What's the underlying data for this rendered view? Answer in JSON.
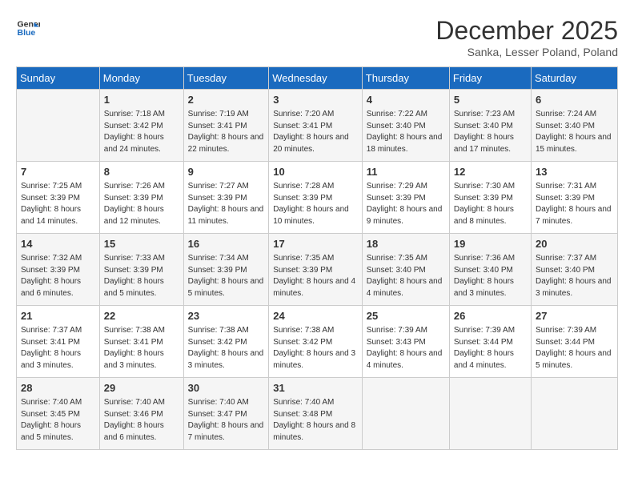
{
  "logo": {
    "line1": "General",
    "line2": "Blue"
  },
  "title": "December 2025",
  "subtitle": "Sanka, Lesser Poland, Poland",
  "headers": [
    "Sunday",
    "Monday",
    "Tuesday",
    "Wednesday",
    "Thursday",
    "Friday",
    "Saturday"
  ],
  "weeks": [
    [
      {
        "day": "",
        "sunrise": "",
        "sunset": "",
        "daylight": ""
      },
      {
        "day": "1",
        "sunrise": "Sunrise: 7:18 AM",
        "sunset": "Sunset: 3:42 PM",
        "daylight": "Daylight: 8 hours and 24 minutes."
      },
      {
        "day": "2",
        "sunrise": "Sunrise: 7:19 AM",
        "sunset": "Sunset: 3:41 PM",
        "daylight": "Daylight: 8 hours and 22 minutes."
      },
      {
        "day": "3",
        "sunrise": "Sunrise: 7:20 AM",
        "sunset": "Sunset: 3:41 PM",
        "daylight": "Daylight: 8 hours and 20 minutes."
      },
      {
        "day": "4",
        "sunrise": "Sunrise: 7:22 AM",
        "sunset": "Sunset: 3:40 PM",
        "daylight": "Daylight: 8 hours and 18 minutes."
      },
      {
        "day": "5",
        "sunrise": "Sunrise: 7:23 AM",
        "sunset": "Sunset: 3:40 PM",
        "daylight": "Daylight: 8 hours and 17 minutes."
      },
      {
        "day": "6",
        "sunrise": "Sunrise: 7:24 AM",
        "sunset": "Sunset: 3:40 PM",
        "daylight": "Daylight: 8 hours and 15 minutes."
      }
    ],
    [
      {
        "day": "7",
        "sunrise": "Sunrise: 7:25 AM",
        "sunset": "Sunset: 3:39 PM",
        "daylight": "Daylight: 8 hours and 14 minutes."
      },
      {
        "day": "8",
        "sunrise": "Sunrise: 7:26 AM",
        "sunset": "Sunset: 3:39 PM",
        "daylight": "Daylight: 8 hours and 12 minutes."
      },
      {
        "day": "9",
        "sunrise": "Sunrise: 7:27 AM",
        "sunset": "Sunset: 3:39 PM",
        "daylight": "Daylight: 8 hours and 11 minutes."
      },
      {
        "day": "10",
        "sunrise": "Sunrise: 7:28 AM",
        "sunset": "Sunset: 3:39 PM",
        "daylight": "Daylight: 8 hours and 10 minutes."
      },
      {
        "day": "11",
        "sunrise": "Sunrise: 7:29 AM",
        "sunset": "Sunset: 3:39 PM",
        "daylight": "Daylight: 8 hours and 9 minutes."
      },
      {
        "day": "12",
        "sunrise": "Sunrise: 7:30 AM",
        "sunset": "Sunset: 3:39 PM",
        "daylight": "Daylight: 8 hours and 8 minutes."
      },
      {
        "day": "13",
        "sunrise": "Sunrise: 7:31 AM",
        "sunset": "Sunset: 3:39 PM",
        "daylight": "Daylight: 8 hours and 7 minutes."
      }
    ],
    [
      {
        "day": "14",
        "sunrise": "Sunrise: 7:32 AM",
        "sunset": "Sunset: 3:39 PM",
        "daylight": "Daylight: 8 hours and 6 minutes."
      },
      {
        "day": "15",
        "sunrise": "Sunrise: 7:33 AM",
        "sunset": "Sunset: 3:39 PM",
        "daylight": "Daylight: 8 hours and 5 minutes."
      },
      {
        "day": "16",
        "sunrise": "Sunrise: 7:34 AM",
        "sunset": "Sunset: 3:39 PM",
        "daylight": "Daylight: 8 hours and 5 minutes."
      },
      {
        "day": "17",
        "sunrise": "Sunrise: 7:35 AM",
        "sunset": "Sunset: 3:39 PM",
        "daylight": "Daylight: 8 hours and 4 minutes."
      },
      {
        "day": "18",
        "sunrise": "Sunrise: 7:35 AM",
        "sunset": "Sunset: 3:40 PM",
        "daylight": "Daylight: 8 hours and 4 minutes."
      },
      {
        "day": "19",
        "sunrise": "Sunrise: 7:36 AM",
        "sunset": "Sunset: 3:40 PM",
        "daylight": "Daylight: 8 hours and 3 minutes."
      },
      {
        "day": "20",
        "sunrise": "Sunrise: 7:37 AM",
        "sunset": "Sunset: 3:40 PM",
        "daylight": "Daylight: 8 hours and 3 minutes."
      }
    ],
    [
      {
        "day": "21",
        "sunrise": "Sunrise: 7:37 AM",
        "sunset": "Sunset: 3:41 PM",
        "daylight": "Daylight: 8 hours and 3 minutes."
      },
      {
        "day": "22",
        "sunrise": "Sunrise: 7:38 AM",
        "sunset": "Sunset: 3:41 PM",
        "daylight": "Daylight: 8 hours and 3 minutes."
      },
      {
        "day": "23",
        "sunrise": "Sunrise: 7:38 AM",
        "sunset": "Sunset: 3:42 PM",
        "daylight": "Daylight: 8 hours and 3 minutes."
      },
      {
        "day": "24",
        "sunrise": "Sunrise: 7:38 AM",
        "sunset": "Sunset: 3:42 PM",
        "daylight": "Daylight: 8 hours and 3 minutes."
      },
      {
        "day": "25",
        "sunrise": "Sunrise: 7:39 AM",
        "sunset": "Sunset: 3:43 PM",
        "daylight": "Daylight: 8 hours and 4 minutes."
      },
      {
        "day": "26",
        "sunrise": "Sunrise: 7:39 AM",
        "sunset": "Sunset: 3:44 PM",
        "daylight": "Daylight: 8 hours and 4 minutes."
      },
      {
        "day": "27",
        "sunrise": "Sunrise: 7:39 AM",
        "sunset": "Sunset: 3:44 PM",
        "daylight": "Daylight: 8 hours and 5 minutes."
      }
    ],
    [
      {
        "day": "28",
        "sunrise": "Sunrise: 7:40 AM",
        "sunset": "Sunset: 3:45 PM",
        "daylight": "Daylight: 8 hours and 5 minutes."
      },
      {
        "day": "29",
        "sunrise": "Sunrise: 7:40 AM",
        "sunset": "Sunset: 3:46 PM",
        "daylight": "Daylight: 8 hours and 6 minutes."
      },
      {
        "day": "30",
        "sunrise": "Sunrise: 7:40 AM",
        "sunset": "Sunset: 3:47 PM",
        "daylight": "Daylight: 8 hours and 7 minutes."
      },
      {
        "day": "31",
        "sunrise": "Sunrise: 7:40 AM",
        "sunset": "Sunset: 3:48 PM",
        "daylight": "Daylight: 8 hours and 8 minutes."
      },
      {
        "day": "",
        "sunrise": "",
        "sunset": "",
        "daylight": ""
      },
      {
        "day": "",
        "sunrise": "",
        "sunset": "",
        "daylight": ""
      },
      {
        "day": "",
        "sunrise": "",
        "sunset": "",
        "daylight": ""
      }
    ]
  ]
}
